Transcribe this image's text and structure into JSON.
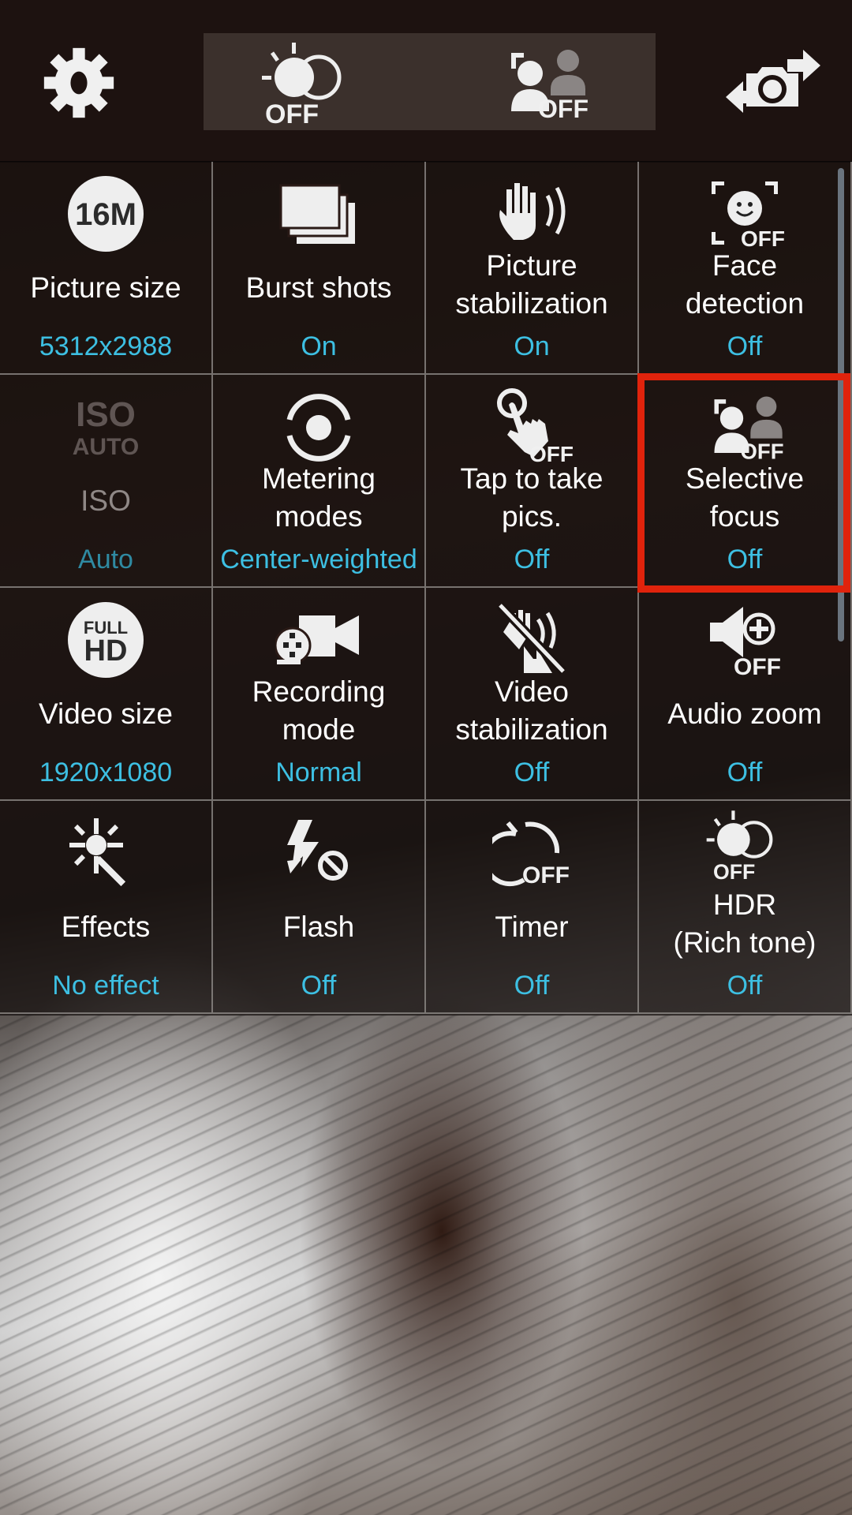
{
  "top_bar": {
    "settings_icon": "gear-icon",
    "quick_settings": [
      {
        "id": "hdr",
        "icon": "hdr-rich-tone-icon",
        "badge": "OFF"
      },
      {
        "id": "selective_focus",
        "icon": "selective-focus-icon",
        "badge": "OFF"
      }
    ],
    "switch_camera_icon": "switch-camera-icon"
  },
  "settings_grid": [
    {
      "label": "Picture size",
      "value": "5312x2988",
      "icon": "picture-size-16m-icon",
      "icon_text": "16M",
      "enabled": true
    },
    {
      "label": "Burst shots",
      "value": "On",
      "icon": "burst-shots-icon",
      "enabled": true
    },
    {
      "label": "Picture stabilization",
      "label_lines": [
        "Picture",
        "stabilization"
      ],
      "value": "On",
      "icon": "picture-stabilization-icon",
      "enabled": true
    },
    {
      "label": "Face detection",
      "label_lines": [
        "Face",
        "detection"
      ],
      "value": "Off",
      "icon": "face-detection-icon",
      "badge": "OFF",
      "enabled": true
    },
    {
      "label": "ISO",
      "value": "Auto",
      "icon": "iso-auto-icon",
      "icon_text": [
        "ISO",
        "AUTO"
      ],
      "enabled": false
    },
    {
      "label": "Metering modes",
      "label_lines": [
        "Metering",
        "modes"
      ],
      "value": "Center-weighted",
      "icon": "metering-icon",
      "enabled": true
    },
    {
      "label": "Tap to take pics.",
      "label_lines": [
        "Tap to take",
        "pics."
      ],
      "value": "Off",
      "icon": "tap-to-take-icon",
      "badge": "OFF",
      "enabled": true
    },
    {
      "label": "Selective focus",
      "label_lines": [
        "Selective",
        "focus"
      ],
      "value": "Off",
      "icon": "selective-focus-icon",
      "badge": "OFF",
      "enabled": true,
      "highlighted": true
    },
    {
      "label": "Video size",
      "value": "1920x1080",
      "icon": "full-hd-icon",
      "icon_text": [
        "FULL",
        "HD"
      ],
      "enabled": true
    },
    {
      "label": "Recording mode",
      "label_lines": [
        "Recording",
        "mode"
      ],
      "value": "Normal",
      "icon": "video-camera-icon",
      "enabled": true
    },
    {
      "label": "Video stabilization",
      "label_lines": [
        "Video",
        "stabilization"
      ],
      "value": "Off",
      "icon": "video-stabilization-off-icon",
      "enabled": true
    },
    {
      "label": "Audio zoom",
      "value": "Off",
      "icon": "audio-zoom-icon",
      "badge": "OFF",
      "enabled": true
    },
    {
      "label": "Effects",
      "value": "No effect",
      "icon": "effects-wand-icon",
      "enabled": true
    },
    {
      "label": "Flash",
      "value": "Off",
      "icon": "flash-off-icon",
      "enabled": true
    },
    {
      "label": "Timer",
      "value": "Off",
      "icon": "timer-icon",
      "badge": "OFF",
      "enabled": true
    },
    {
      "label": "HDR (Rich tone)",
      "label_lines": [
        "HDR",
        "(Rich tone)"
      ],
      "value": "Off",
      "icon": "hdr-rich-tone-icon",
      "badge": "OFF",
      "enabled": true
    }
  ],
  "colors": {
    "value_text": "#3dbfe2",
    "highlight_border": "#e0230c",
    "top_bar_bg": "#1d1210",
    "quick_settings_bg": "#3b302c"
  }
}
